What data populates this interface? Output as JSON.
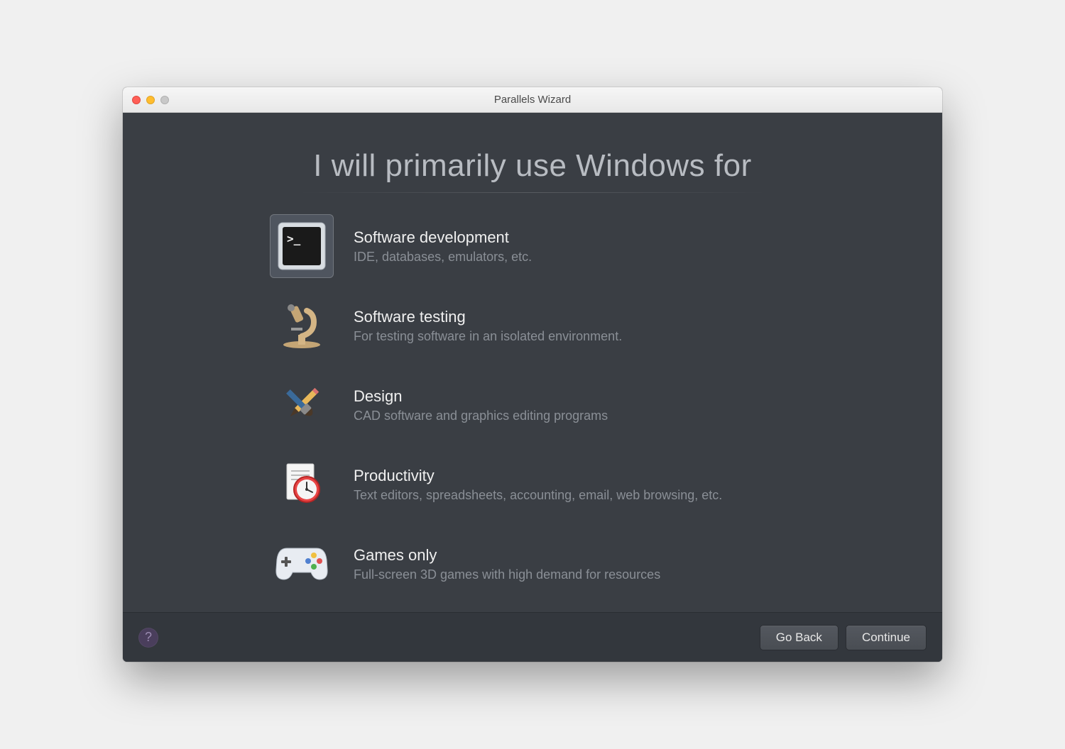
{
  "window": {
    "title": "Parallels Wizard"
  },
  "heading": "I will primarily use Windows for",
  "options": [
    {
      "title": "Software development",
      "desc": "IDE, databases, emulators, etc.",
      "selected": true
    },
    {
      "title": "Software testing",
      "desc": "For testing software in an isolated environment.",
      "selected": false
    },
    {
      "title": "Design",
      "desc": "CAD software and graphics editing programs",
      "selected": false
    },
    {
      "title": "Productivity",
      "desc": "Text editors, spreadsheets, accounting, email, web browsing, etc.",
      "selected": false
    },
    {
      "title": "Games only",
      "desc": "Full-screen 3D games with high demand for resources",
      "selected": false
    }
  ],
  "footer": {
    "help": "?",
    "back": "Go Back",
    "continue": "Continue"
  }
}
